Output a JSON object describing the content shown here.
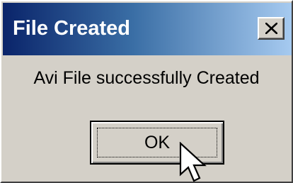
{
  "window": {
    "title": "File Created",
    "close_icon": "close-x-icon",
    "title_gradient": [
      "#0a246a",
      "#a6caf0"
    ],
    "face_color": "#d4d0c8"
  },
  "message": {
    "text": "Avi File successfully Created"
  },
  "buttons": {
    "ok_label": "OK"
  },
  "cursor": {
    "icon": "arrow-pointer-icon"
  }
}
